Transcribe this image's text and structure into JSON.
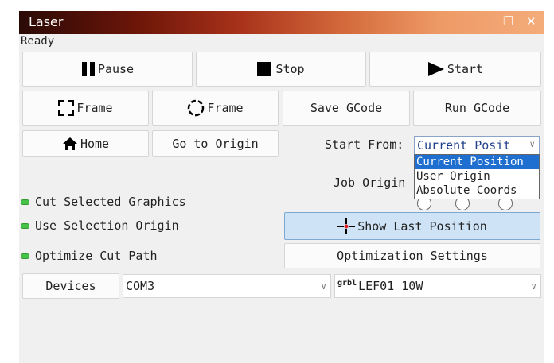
{
  "window": {
    "title": "Laser",
    "restore_icon": "restore-window-icon",
    "close_icon": "close-icon"
  },
  "status": "Ready",
  "controls": {
    "pause": "Pause",
    "stop": "Stop",
    "start": "Start"
  },
  "row2": {
    "frame_rect": "Frame",
    "frame_circle": "Frame",
    "save_gcode": "Save GCode",
    "run_gcode": "Run GCode"
  },
  "row3": {
    "home": "Home",
    "go_origin": "Go to Origin",
    "start_from_label": "Start From:",
    "start_from_value": "Current Posit"
  },
  "start_from_options": [
    "Current Position",
    "User Origin",
    "Absolute Coords"
  ],
  "job_origin": {
    "label": "Job Origin"
  },
  "checks": {
    "cut_selected": "Cut Selected Graphics",
    "use_selection_origin": "Use Selection Origin",
    "optimize_cut": "Optimize Cut Path"
  },
  "buttons": {
    "show_last": "Show Last Position",
    "optimization": "Optimization Settings",
    "devices": "Devices"
  },
  "port": {
    "value": "COM3"
  },
  "device": {
    "badge": "grbl",
    "value": "LEF01 10W"
  },
  "colors": {
    "accent": "#1e6fd0",
    "selected_button": "#cfe3f7",
    "toggle_on": "#47c247",
    "crosshair": "#e02020"
  }
}
